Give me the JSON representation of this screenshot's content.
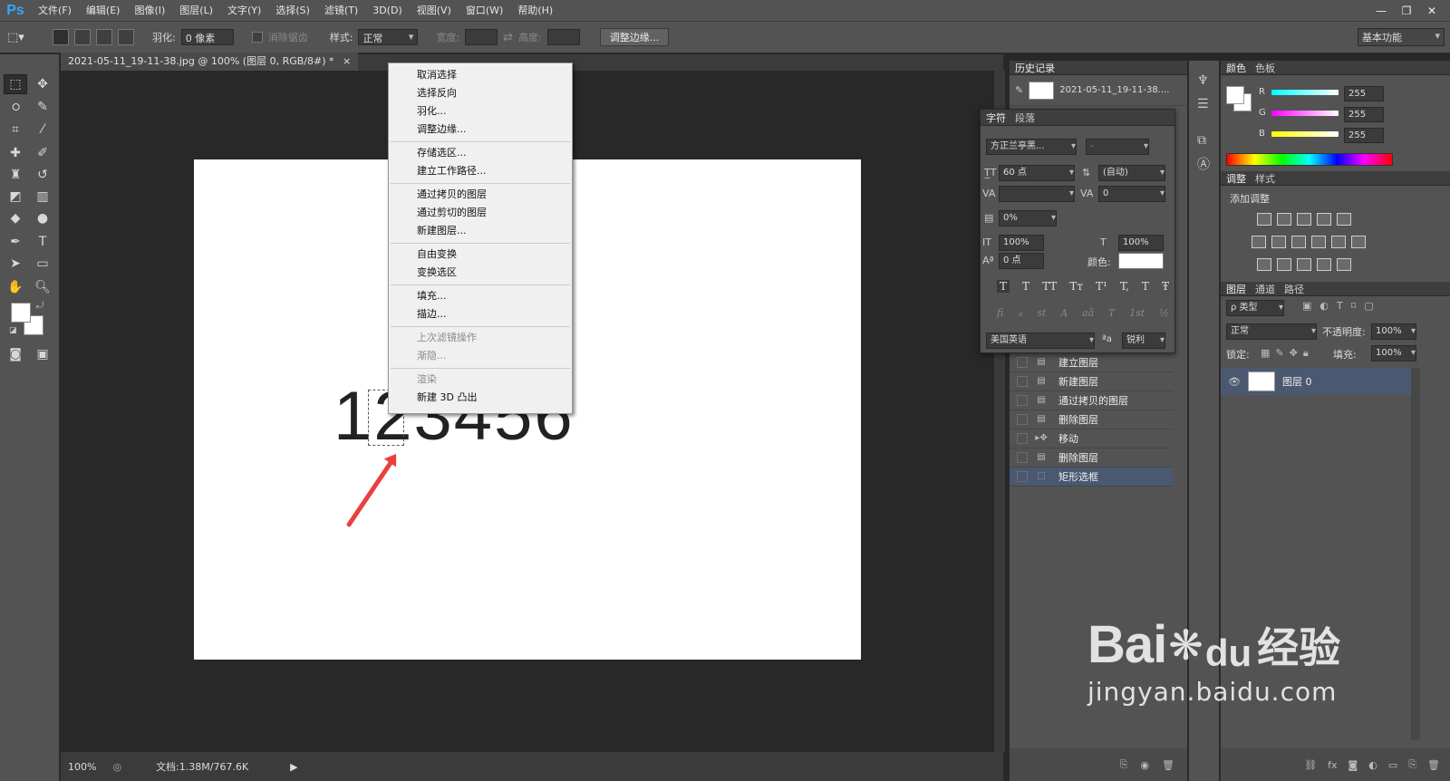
{
  "app": {
    "logo": "Ps",
    "menu": [
      "文件(F)",
      "编辑(E)",
      "图像(I)",
      "图层(L)",
      "文字(Y)",
      "选择(S)",
      "滤镜(T)",
      "3D(D)",
      "视图(V)",
      "窗口(W)",
      "帮助(H)"
    ],
    "window_controls": [
      "—",
      "❐",
      "✕"
    ]
  },
  "options_bar": {
    "feather_label": "羽化:",
    "feather_value": "0 像素",
    "antialias_label": "消除锯齿",
    "style_label": "样式:",
    "style_value": "正常",
    "width_label": "宽度:",
    "height_label": "高度:",
    "refine_button": "调整边缘...",
    "workspace": "基本功能"
  },
  "document": {
    "tab_title": "2021-05-11_19-11-38.jpg @ 100% (图层 0, RGB/8#) *",
    "close": "×",
    "canvas_text": "123456",
    "zoom": "100%",
    "doc_info": "文档:1.38M/767.6K"
  },
  "context_menu": {
    "groups": [
      [
        {
          "label": "取消选择",
          "disabled": false
        },
        {
          "label": "选择反向",
          "disabled": false
        },
        {
          "label": "羽化...",
          "disabled": false
        },
        {
          "label": "调整边缘...",
          "disabled": false
        }
      ],
      [
        {
          "label": "存储选区...",
          "disabled": false
        },
        {
          "label": "建立工作路径...",
          "disabled": false
        }
      ],
      [
        {
          "label": "通过拷贝的图层",
          "disabled": false
        },
        {
          "label": "通过剪切的图层",
          "disabled": false
        },
        {
          "label": "新建图层...",
          "disabled": false
        }
      ],
      [
        {
          "label": "自由变换",
          "disabled": false
        },
        {
          "label": "变换选区",
          "disabled": false
        }
      ],
      [
        {
          "label": "填充...",
          "disabled": false
        },
        {
          "label": "描边...",
          "disabled": false
        }
      ],
      [
        {
          "label": "上次滤镜操作",
          "disabled": true
        },
        {
          "label": "渐隐...",
          "disabled": true
        }
      ],
      [
        {
          "label": "渲染",
          "disabled": true
        },
        {
          "label": "新建 3D 凸出",
          "disabled": false
        }
      ]
    ]
  },
  "history_panel": {
    "title": "历史记录",
    "snapshot": "2021-05-11_19-11-38....",
    "items": [
      {
        "label": "建立图层",
        "icon": "doc",
        "selected": false
      },
      {
        "label": "新建图层",
        "icon": "doc",
        "selected": false
      },
      {
        "label": "通过拷贝的图层",
        "icon": "doc",
        "selected": false
      },
      {
        "label": "删除图层",
        "icon": "doc",
        "selected": false
      },
      {
        "label": "移动",
        "icon": "move",
        "selected": false
      },
      {
        "label": "删除图层",
        "icon": "doc",
        "selected": false
      },
      {
        "label": "矩形选框",
        "icon": "marquee",
        "selected": true
      }
    ]
  },
  "character_panel": {
    "tabs": [
      "字符",
      "段落"
    ],
    "font_family": "方正兰亭黑...",
    "font_style": "-",
    "size": "60 点",
    "leading": "(自动)",
    "kerning": "",
    "tracking": "0",
    "tsume": "0%",
    "vscale": "100%",
    "hscale": "100%",
    "baseline": "0 点",
    "color_label": "颜色:",
    "style_buttons": [
      "T",
      "T",
      "TT",
      "Tт",
      "T¹",
      "T,",
      "T",
      "Ŧ"
    ],
    "opentype_buttons": [
      "fi",
      "ℴ",
      "st",
      "A",
      "aā",
      "T",
      "1st",
      "½"
    ],
    "language": "美国英语",
    "aa_label": "ªa",
    "antialias": "锐利"
  },
  "color_panel": {
    "tabs": [
      "颜色",
      "色板"
    ],
    "channels": [
      {
        "name": "R",
        "value": "255"
      },
      {
        "name": "G",
        "value": "255"
      },
      {
        "name": "B",
        "value": "255"
      }
    ]
  },
  "adjust_panel": {
    "tabs": [
      "调整",
      "样式"
    ],
    "title": "添加调整"
  },
  "layers_panel": {
    "tabs": [
      "图层",
      "通道",
      "路径"
    ],
    "filter": "ρ 类型",
    "blend_mode": "正常",
    "opacity_label": "不透明度:",
    "opacity": "100%",
    "lock_label": "锁定:",
    "fill_label": "填充:",
    "fill": "100%",
    "layer_name": "图层 0"
  },
  "watermark": {
    "brand": "Bai",
    "brand2": "du",
    "cn": "经验",
    "url": "jingyan.baidu.com"
  }
}
